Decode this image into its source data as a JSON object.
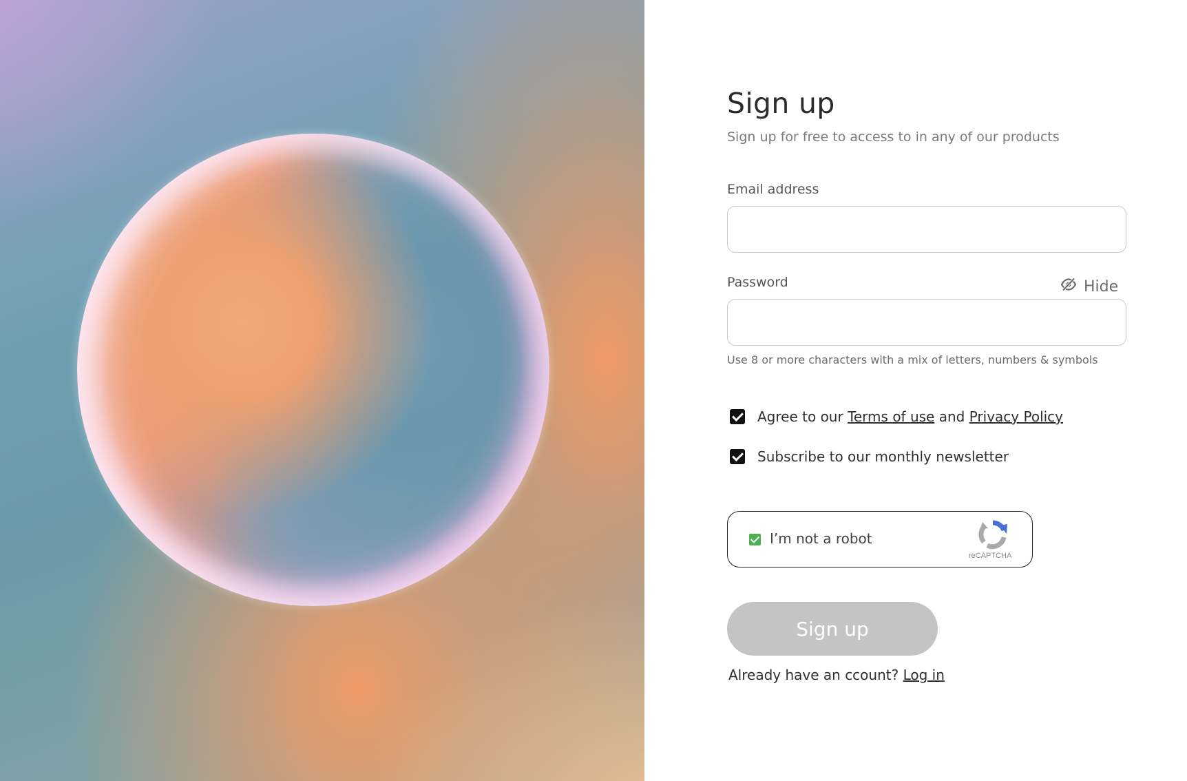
{
  "hero": {
    "image": "gradient-orb-art"
  },
  "form": {
    "title": "Sign up",
    "subtitle": "Sign up for free to access to in any of our products",
    "email": {
      "label": "Email address",
      "value": "",
      "placeholder": ""
    },
    "password": {
      "label": "Password",
      "value": "",
      "placeholder": "",
      "toggle_label": "Hide",
      "toggle_icon": "eye-slash-icon",
      "hint": "Use 8 or more characters with a mix of letters, numbers & symbols"
    },
    "terms": {
      "checked": true,
      "prefix": "Agree to our",
      "terms_link": "Terms of use",
      "middle": "and",
      "privacy_link": "Privacy Policy"
    },
    "newsletter": {
      "checked": true,
      "label": "Subscribe to our monthly newsletter"
    },
    "captcha": {
      "checked": true,
      "label": "I’m not a robot",
      "brand": "reCAPTCHA"
    },
    "submit_label": "Sign up",
    "login_prompt": "Already have an ccount?",
    "login_link": "Log in"
  },
  "colors": {
    "button_disabled": "#c4c4c4",
    "checkbox": "#111111",
    "captcha_check": "#4caf50",
    "captcha_blue": "#4a6fd6",
    "captcha_grey": "#a9a9a9"
  }
}
